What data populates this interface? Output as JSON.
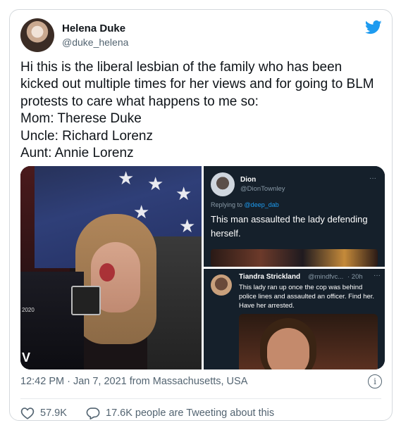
{
  "tweet": {
    "author_name": "Helena Duke",
    "author_handle": "@duke_helena",
    "text": "Hi this is the liberal lesbian of the family who has been kicked out multiple times for her views and for going to BLM protests to care what happens to me so:\nMom: Therese Duke\nUncle: Richard Lorenz\nAunt: Annie Lorenz",
    "timestamp": "12:42 PM · Jan 7, 2021 from Massachusetts, USA",
    "likes": "57.9K",
    "conversation": "17.6K people are Tweeting about this"
  },
  "embedded_1": {
    "name": "Dion",
    "handle": "@DionTownley",
    "reply_prefix": "Replying to",
    "reply_to": "@deep_dab",
    "text": "This man assaulted the lady defending herself.",
    "more": "···"
  },
  "embedded_2": {
    "name": "Tiandra Strickland",
    "handle": "@mindfvc...",
    "time": "· 20h",
    "text": "This lady ran up once the cop was behind police lines and assaulted an officer. Find her. Have her arrested.",
    "more": "···"
  },
  "photo_marks": {
    "year": "2020",
    "letter": "V"
  },
  "colors": {
    "twitter_blue": "#1d9bf0",
    "text_primary": "#0f1419",
    "text_secondary": "#536471",
    "dark_bg": "#15202b"
  },
  "icons": [
    "twitter-bird-icon",
    "info-icon",
    "heart-icon",
    "chat-bubble-icon"
  ]
}
